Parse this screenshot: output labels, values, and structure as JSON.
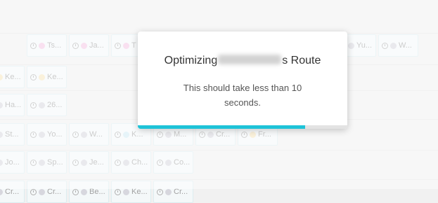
{
  "dialog": {
    "title_prefix": "Optimizing",
    "title_suffix": "s Route",
    "message": "This should take less than 10 seconds.",
    "progress": 0.8
  },
  "colors": {
    "accent": "#1ec3d8",
    "pink": "#f5b8df",
    "gray": "#cfcfd8",
    "yellow": "#f8e3ac",
    "lightblue": "#c8eaf5"
  },
  "schedule": {
    "row1": [
      {
        "label": "Ts...",
        "color": "pink"
      },
      {
        "label": "Ja...",
        "color": "pink"
      },
      {
        "label": "T",
        "color": "pink"
      },
      {
        "label": "Yu...",
        "color": "gray"
      },
      {
        "label": "W...",
        "color": "gray"
      }
    ],
    "row2": [
      {
        "label": "Ke...",
        "color": "yellow"
      },
      {
        "label": "Ke...",
        "color": "yellow"
      }
    ],
    "row3": [
      {
        "label": "Ha...",
        "color": "gray"
      },
      {
        "label": "26...",
        "color": "gray"
      }
    ],
    "row4": [
      {
        "label": "St...",
        "color": "gray"
      },
      {
        "label": "Yo...",
        "color": "gray"
      },
      {
        "label": "W...",
        "color": "gray"
      },
      {
        "label": "K...",
        "color": "lightblue"
      },
      {
        "label": "M...",
        "color": "gray"
      },
      {
        "label": "Cr...",
        "color": "gray"
      },
      {
        "label": "Fr...",
        "color": "yellow"
      }
    ],
    "row5": [
      {
        "label": "Jo...",
        "color": "gray"
      },
      {
        "label": "Sp...",
        "color": "gray"
      },
      {
        "label": "Je...",
        "color": "gray"
      },
      {
        "label": "Ch...",
        "color": "gray"
      },
      {
        "label": "Co...",
        "color": "gray"
      }
    ],
    "row6": [
      {
        "label": "Cr...",
        "color": "gray"
      },
      {
        "label": "Cr...",
        "color": "gray"
      },
      {
        "label": "Be...",
        "color": "gray"
      },
      {
        "label": "Ke...",
        "color": "gray"
      },
      {
        "label": "Cr...",
        "color": "gray"
      }
    ]
  }
}
